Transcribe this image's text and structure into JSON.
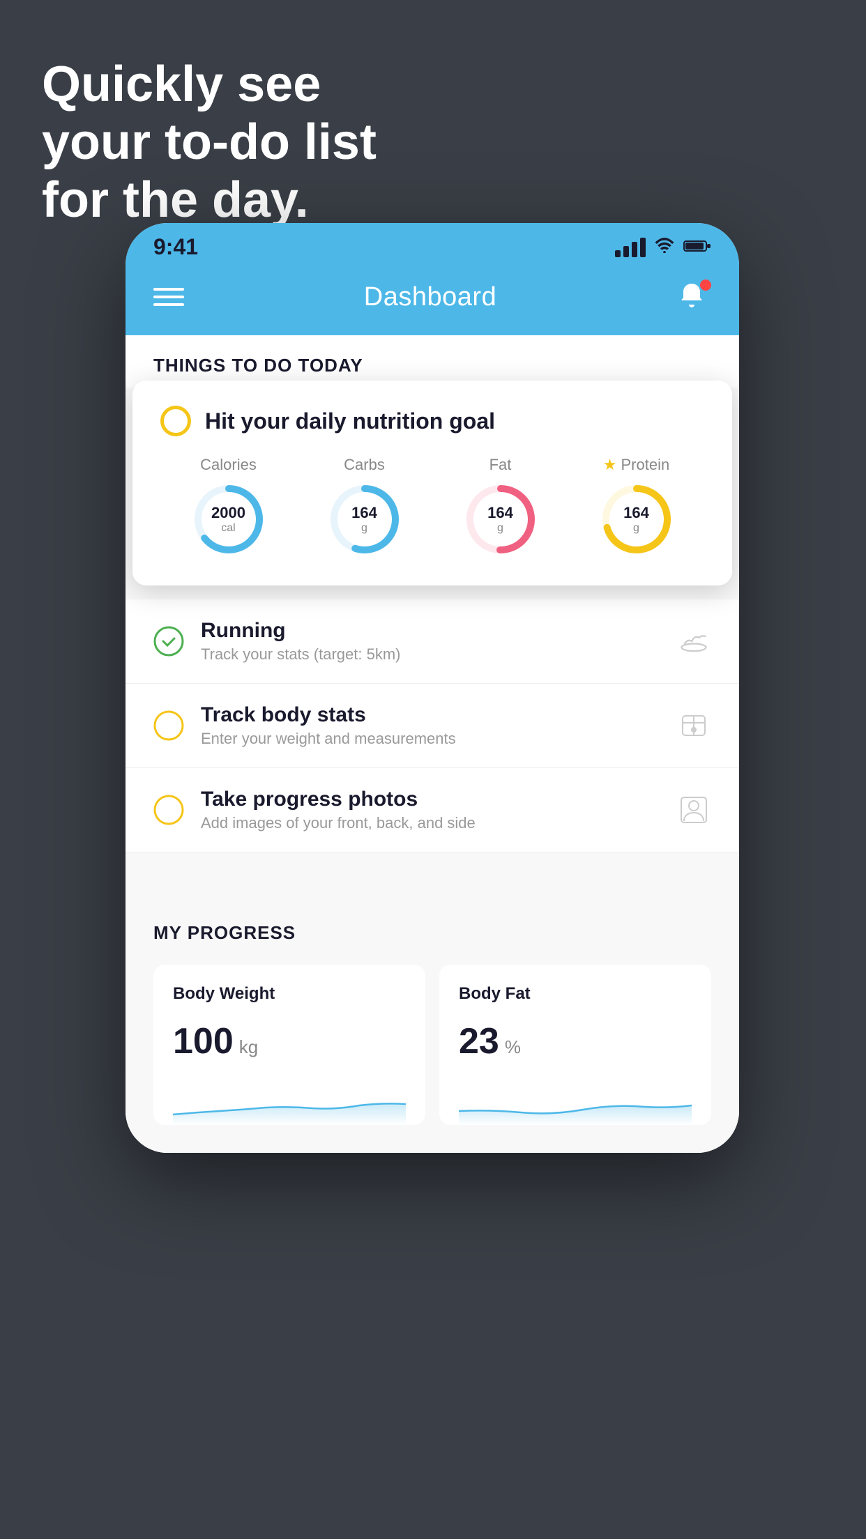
{
  "headline": {
    "line1": "Quickly see",
    "line2": "your to-do list",
    "line3": "for the day."
  },
  "status_bar": {
    "time": "9:41",
    "signal_label": "signal",
    "wifi_label": "wifi",
    "battery_label": "battery"
  },
  "header": {
    "title": "Dashboard",
    "hamburger_label": "menu",
    "bell_label": "notifications"
  },
  "things_section": {
    "title": "THINGS TO DO TODAY"
  },
  "nutrition_card": {
    "title": "Hit your daily nutrition goal",
    "macros": [
      {
        "label": "Calories",
        "value": "2000",
        "unit": "cal",
        "color": "#4db8e8",
        "pct": 65,
        "star": false
      },
      {
        "label": "Carbs",
        "value": "164",
        "unit": "g",
        "color": "#4db8e8",
        "pct": 55,
        "star": false
      },
      {
        "label": "Fat",
        "value": "164",
        "unit": "g",
        "color": "#f06080",
        "pct": 50,
        "star": false
      },
      {
        "label": "Protein",
        "value": "164",
        "unit": "g",
        "color": "#f5c518",
        "pct": 70,
        "star": true
      }
    ]
  },
  "todo_items": [
    {
      "title": "Running",
      "subtitle": "Track your stats (target: 5km)",
      "check_type": "green",
      "icon": "shoe"
    },
    {
      "title": "Track body stats",
      "subtitle": "Enter your weight and measurements",
      "check_type": "yellow",
      "icon": "scale"
    },
    {
      "title": "Take progress photos",
      "subtitle": "Add images of your front, back, and side",
      "check_type": "yellow",
      "icon": "person"
    }
  ],
  "progress_section": {
    "title": "MY PROGRESS",
    "cards": [
      {
        "title": "Body Weight",
        "value": "100",
        "unit": "kg"
      },
      {
        "title": "Body Fat",
        "value": "23",
        "unit": "%"
      }
    ]
  }
}
